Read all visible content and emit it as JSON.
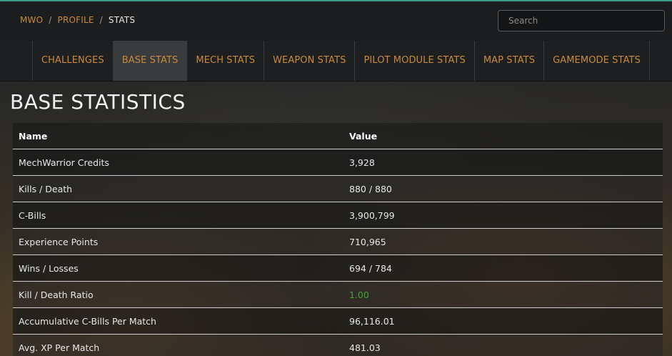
{
  "breadcrumb": {
    "items": [
      "MWO",
      "PROFILE"
    ],
    "separator": "/",
    "current": "STATS"
  },
  "search": {
    "placeholder": "Search",
    "value": ""
  },
  "tabs": [
    {
      "label": "CHALLENGES",
      "active": false
    },
    {
      "label": "BASE STATS",
      "active": true
    },
    {
      "label": "MECH STATS",
      "active": false
    },
    {
      "label": "WEAPON STATS",
      "active": false
    },
    {
      "label": "PILOT MODULE STATS",
      "active": false
    },
    {
      "label": "MAP STATS",
      "active": false
    },
    {
      "label": "GAMEMODE STATS",
      "active": false
    }
  ],
  "page": {
    "title": "BASE STATISTICS"
  },
  "table": {
    "headers": {
      "name": "Name",
      "value": "Value"
    },
    "rows": [
      {
        "name": "MechWarrior Credits",
        "value": "3,928"
      },
      {
        "name": "Kills / Death",
        "value": "880 / 880"
      },
      {
        "name": "C-Bills",
        "value": "3,900,799"
      },
      {
        "name": "Experience Points",
        "value": "710,965"
      },
      {
        "name": "Wins / Losses",
        "value": "694 / 784"
      },
      {
        "name": "Kill / Death Ratio",
        "value": "1.00"
      },
      {
        "name": "Accumulative C-Bills Per Match",
        "value": "96,116.01"
      },
      {
        "name": "Avg. XP Per Match",
        "value": "481.03"
      }
    ]
  },
  "colors": {
    "accent_orange": "#c78a3e",
    "positive_green": "#3fa33f",
    "top_edge": "#3a9a86"
  }
}
